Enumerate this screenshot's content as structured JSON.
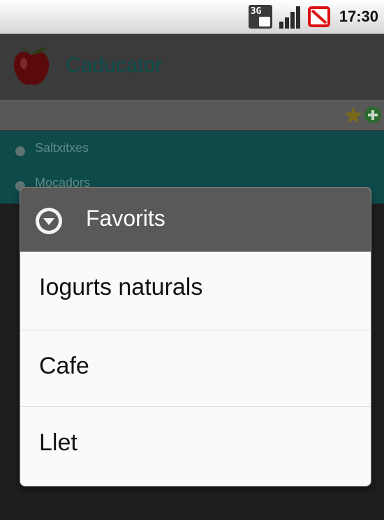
{
  "status_bar": {
    "network_label": "3G",
    "time": "17:30",
    "icons": [
      "network-3g-icon",
      "signal-bars-icon",
      "no-battery-warning-icon"
    ]
  },
  "app": {
    "title": "Caducator",
    "toolbar_icons": [
      "star-icon",
      "add-icon"
    ],
    "list_items": [
      {
        "label": "Saltxitxes"
      },
      {
        "label": "Mocadors"
      }
    ]
  },
  "dialog": {
    "title": "Favorits",
    "header_icon": "dropdown-circle-icon",
    "options": [
      {
        "label": "Iogurts naturals"
      },
      {
        "label": "Cafe"
      },
      {
        "label": "Llet"
      }
    ]
  },
  "colors": {
    "status_bar": "#e8e8e8",
    "dialog_header": "#595959",
    "dialog_body": "#fafafa",
    "list_highlight": "#0f4a4a",
    "app_title": "#0b4e4c"
  }
}
